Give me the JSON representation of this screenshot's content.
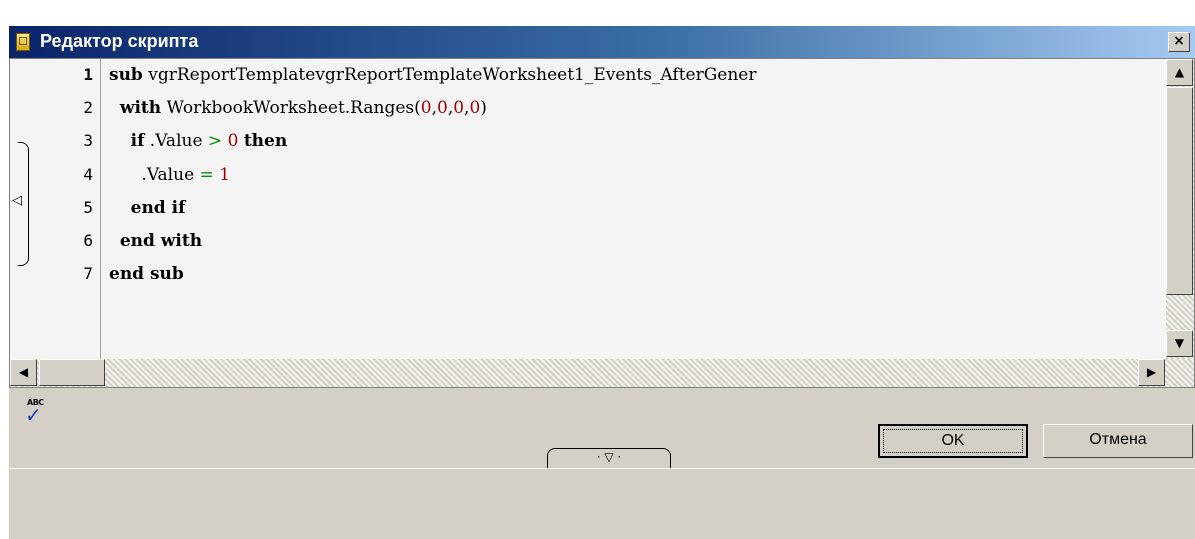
{
  "window": {
    "title": "Редактор скрипта",
    "close_label": "×"
  },
  "editor": {
    "line_numbers": [
      "1",
      "2",
      "3",
      "4",
      "5",
      "6",
      "7"
    ],
    "lines": [
      [
        {
          "t": "sub",
          "c": "kw"
        },
        {
          "t": " vgrReportTemplatevgrReportTemplateWorksheet1_Events_AfterGener",
          "c": ""
        }
      ],
      [
        {
          "t": "  ",
          "c": ""
        },
        {
          "t": "with",
          "c": "kw"
        },
        {
          "t": " WorkbookWorksheet.Ranges(",
          "c": ""
        },
        {
          "t": "0",
          "c": "num"
        },
        {
          "t": ",",
          "c": ""
        },
        {
          "t": "0",
          "c": "num"
        },
        {
          "t": ",",
          "c": ""
        },
        {
          "t": "0",
          "c": "num"
        },
        {
          "t": ",",
          "c": ""
        },
        {
          "t": "0",
          "c": "num"
        },
        {
          "t": ")",
          "c": ""
        }
      ],
      [
        {
          "t": "    ",
          "c": ""
        },
        {
          "t": "if",
          "c": "kw"
        },
        {
          "t": " .Value ",
          "c": ""
        },
        {
          "t": ">",
          "c": "op"
        },
        {
          "t": " ",
          "c": ""
        },
        {
          "t": "0",
          "c": "num"
        },
        {
          "t": " ",
          "c": ""
        },
        {
          "t": "then",
          "c": "kw"
        }
      ],
      [
        {
          "t": "      .Value ",
          "c": ""
        },
        {
          "t": "=",
          "c": "op"
        },
        {
          "t": " ",
          "c": ""
        },
        {
          "t": "1",
          "c": "num"
        }
      ],
      [
        {
          "t": "    ",
          "c": ""
        },
        {
          "t": "end if",
          "c": "kw"
        }
      ],
      [
        {
          "t": "  ",
          "c": ""
        },
        {
          "t": "end with",
          "c": "kw"
        }
      ],
      [
        {
          "t": "end sub",
          "c": "kw"
        }
      ]
    ],
    "colors": {
      "keyword": "#000000",
      "number": "#9a0000",
      "operator": "#0a8a0a",
      "background": "#f4f4f4"
    }
  },
  "scrollbars": {
    "up_arrow": "▲",
    "down_arrow": "▼",
    "left_arrow": "◀",
    "right_arrow": "▶"
  },
  "toolbar": {
    "spell_icon_text": "ABC",
    "spell_check_glyph": "✓",
    "collapse_handle": "·  ▽  ·",
    "fold_arrow": "◁"
  },
  "buttons": {
    "ok": "OK",
    "cancel": "Отмена"
  },
  "colors": {
    "title_gradient_start": "#0a246a",
    "title_gradient_end": "#a6caf0",
    "window_face": "#d4d0c8"
  }
}
